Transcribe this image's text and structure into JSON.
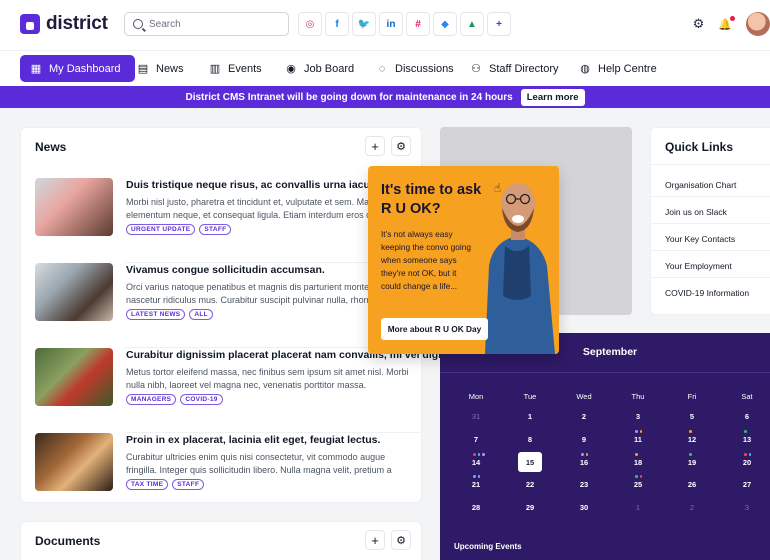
{
  "brand": {
    "name": "district",
    "accent": "#5b2bd9"
  },
  "search": {
    "placeholder": "Search"
  },
  "apps": [
    {
      "name": "instagram-icon",
      "glyph": "◎",
      "color": "#e1306c"
    },
    {
      "name": "facebook-icon",
      "glyph": "f",
      "color": "#1877f2"
    },
    {
      "name": "twitter-icon",
      "glyph": "🐦",
      "color": "#1da1f2"
    },
    {
      "name": "linkedin-icon",
      "glyph": "in",
      "color": "#0a66c2"
    },
    {
      "name": "slack-icon",
      "glyph": "#",
      "color": "#e01e5a"
    },
    {
      "name": "jira-icon",
      "glyph": "◆",
      "color": "#2684ff"
    },
    {
      "name": "google-drive-icon",
      "glyph": "▲",
      "color": "#0f9d58"
    },
    {
      "name": "add-app-icon",
      "glyph": "+",
      "color": "#5b2bd9"
    }
  ],
  "nav": [
    {
      "label": "My Dashboard",
      "icon": "grid-icon",
      "glyph": "▦"
    },
    {
      "label": "News",
      "icon": "newspaper-icon",
      "glyph": "▤"
    },
    {
      "label": "Events",
      "icon": "calendar-icon",
      "glyph": "▥"
    },
    {
      "label": "Job Board",
      "icon": "job-board-icon",
      "glyph": "◉"
    },
    {
      "label": "Discussions",
      "icon": "chat-icon",
      "glyph": "◌"
    },
    {
      "label": "Staff Directory",
      "icon": "people-icon",
      "glyph": "⚇"
    },
    {
      "label": "Help Centre",
      "icon": "help-icon",
      "glyph": "◍"
    }
  ],
  "banner": {
    "message": "District CMS Intranet will be going down for maintenance in 24 hours",
    "button": "Learn more"
  },
  "news": {
    "title": "News",
    "items": [
      {
        "title": "Duis tristique neque risus, ac convallis urna iaculis in",
        "desc": "Morbi nisl justo, pharetra et tincidunt et, vulputate et sem. Mauris quis elementum neque, et consequat ligula. Etiam interdum eros quis lacus",
        "tags": [
          "URGENT UPDATE",
          "STAFF"
        ]
      },
      {
        "title": "Vivamus congue sollicitudin accumsan.",
        "desc": "Orci varius natoque penatibus et magnis dis parturient montes, nascetur ridiculus mus. Curabitur suscipit pulvinar nulla, rhoncus accumsan orci",
        "tags": [
          "LATEST NEWS",
          "ALL"
        ]
      },
      {
        "title": "Curabitur dignissim placerat placerat nam convallis, mi vel dignissim.",
        "desc": "Metus tortor eleifend massa, nec finibus sem ipsum sit amet nisl. Morbi nulla nibh, laoreet vel magna nec, venenatis porttitor massa. Suspendisse finibus...",
        "tags": [
          "MANAGERS",
          "COVID-19"
        ]
      },
      {
        "title": "Proin in ex placerat, lacinia elit eget, feugiat lectus.",
        "desc": "Curabitur ultricies enim quis nisi consectetur, vit commodo augue fringilla. Integer quis sollicitudin libero. Nulla magna velit, pretium a nunc vitae...",
        "tags": [
          "TAX TIME",
          "STAFF"
        ]
      }
    ]
  },
  "documents": {
    "title": "Documents"
  },
  "quick_links": {
    "title": "Quick Links",
    "items": [
      "Organisation Chart",
      "Join us on Slack",
      "Your Key Contacts",
      "Your Employment",
      "COVID-19 Information"
    ]
  },
  "popup": {
    "title": "It's time to ask R U OK?",
    "body": "It's not always easy keeping the convo going when someone says they're not OK, but it could change a life...",
    "button": "More about R U OK Day"
  },
  "calendar": {
    "month": "September",
    "weekdays": [
      "Mon",
      "Tue",
      "Wed",
      "Thu",
      "Fri",
      "Sat"
    ],
    "weeks": [
      [
        "31",
        "1",
        "2",
        "3",
        "5",
        "6"
      ],
      [
        "7",
        "8",
        "9",
        "11",
        "12",
        "13"
      ],
      [
        "14",
        "15",
        "16",
        "18",
        "19",
        "20"
      ],
      [
        "21",
        "22",
        "23",
        "25",
        "26",
        "27"
      ],
      [
        "28",
        "29",
        "30",
        "1",
        "2",
        "3"
      ]
    ],
    "today": "15",
    "upcoming_label": "Upcoming Events"
  }
}
